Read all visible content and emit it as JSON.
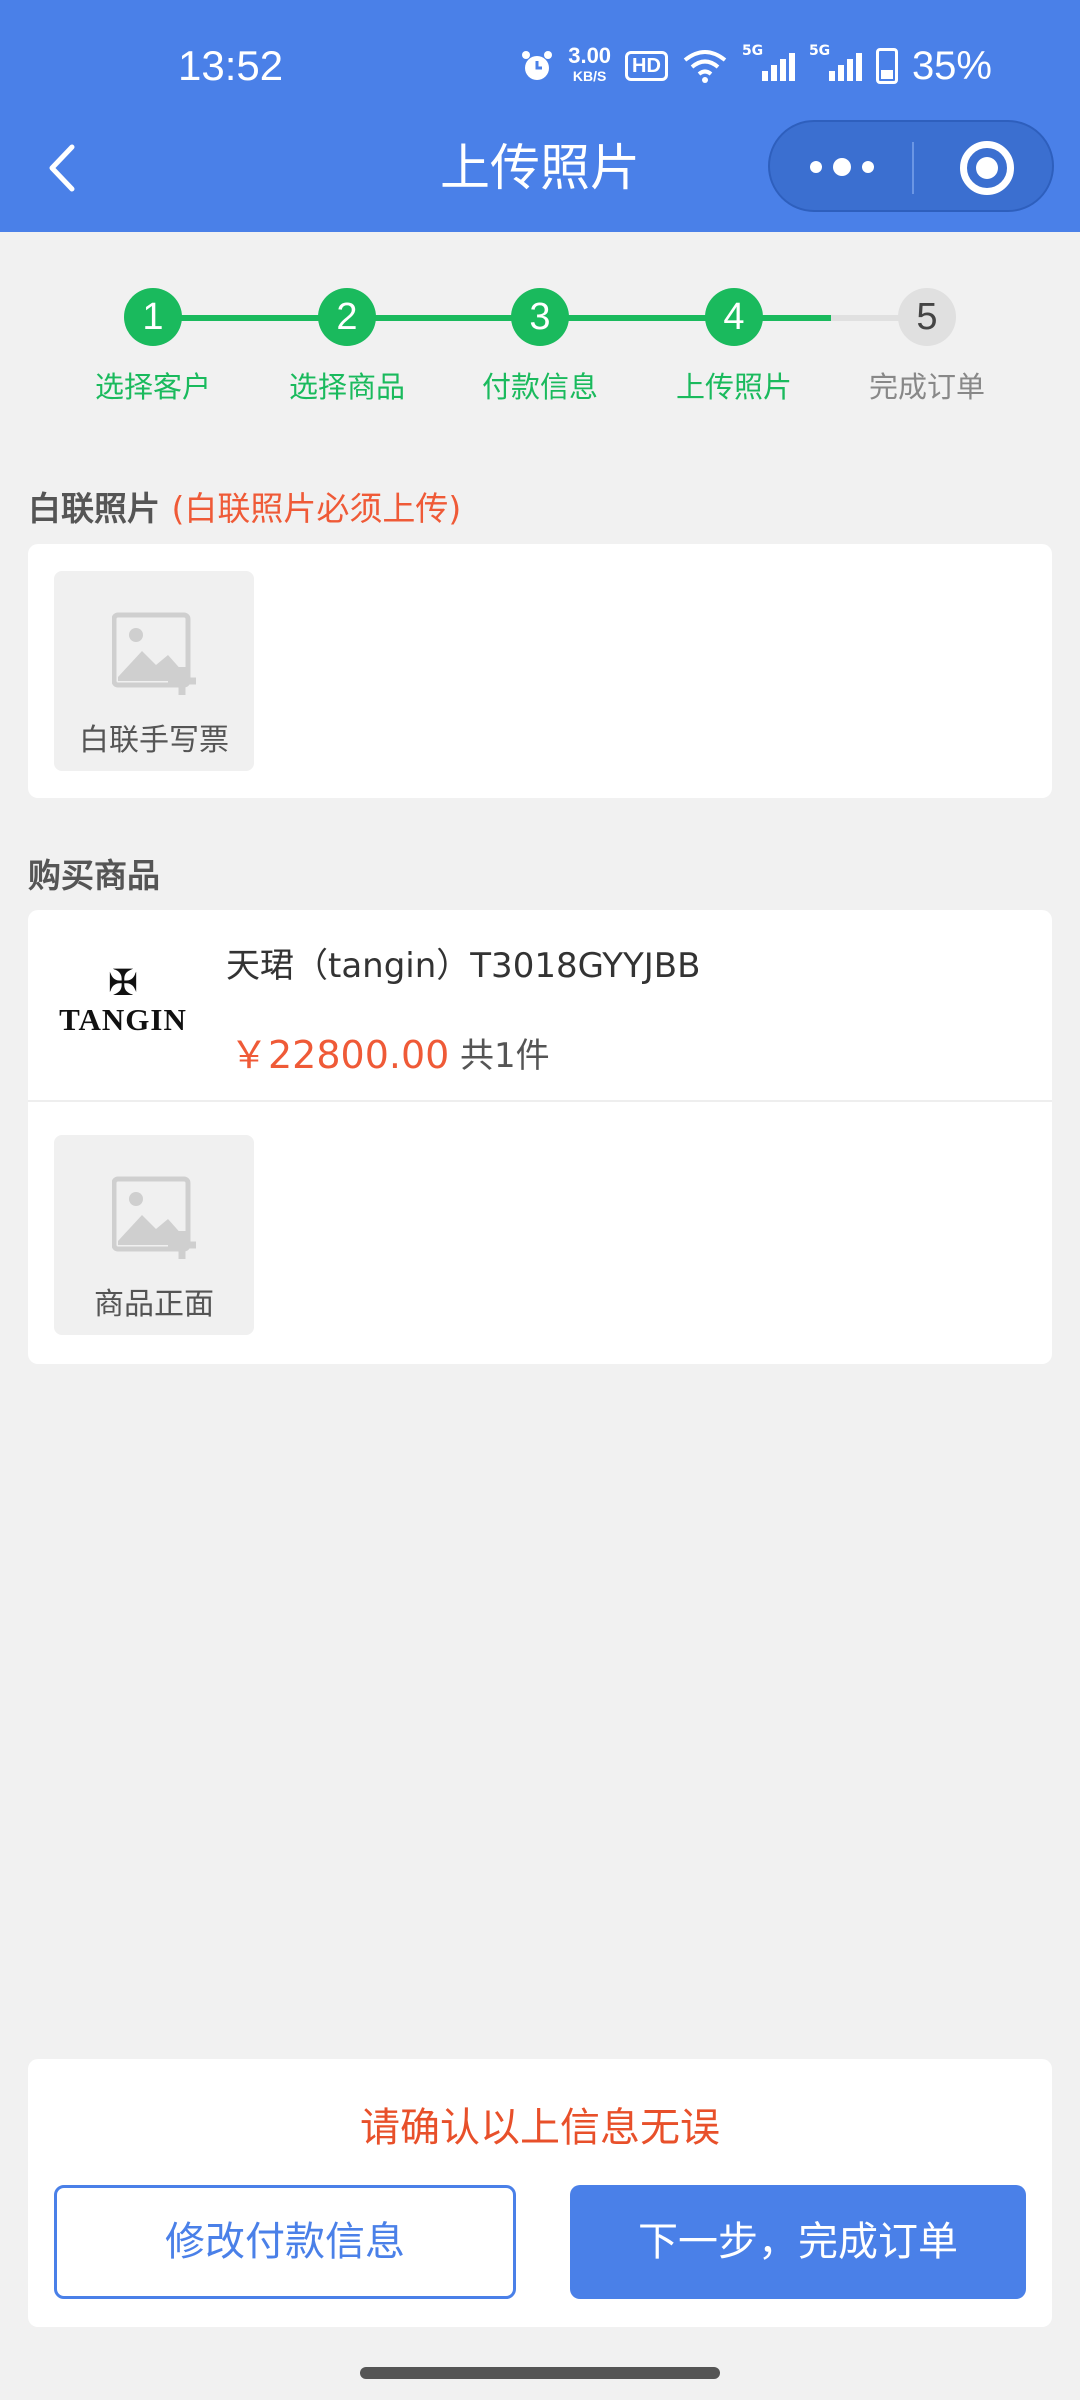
{
  "status_bar": {
    "time": "13:52",
    "net_speed_value": "3.00",
    "net_speed_unit": "KB/S",
    "hd_label": "HD",
    "signal_tag_1": "5G",
    "signal_tag_2": "5G",
    "battery": "35%"
  },
  "nav": {
    "title": "上传照片"
  },
  "steps": [
    {
      "number": "1",
      "label": "选择客户",
      "state": "done"
    },
    {
      "number": "2",
      "label": "选择商品",
      "state": "done"
    },
    {
      "number": "3",
      "label": "付款信息",
      "state": "done"
    },
    {
      "number": "4",
      "label": "上传照片",
      "state": "current"
    },
    {
      "number": "5",
      "label": "完成订单",
      "state": "pending"
    }
  ],
  "receipt_section": {
    "title": "白联照片",
    "note": "(白联照片必须上传)",
    "upload_label": "白联手写票"
  },
  "purchase_section": {
    "title": "购买商品",
    "product": {
      "brand": "TANGIN",
      "name": "天珺（tangin）T3018GYYJBB",
      "price": "￥22800.00",
      "quantity": "共1件"
    },
    "upload_label": "商品正面"
  },
  "footer": {
    "confirm_text": "请确认以上信息无误",
    "modify_button": "修改付款信息",
    "next_button": "下一步，完成订单"
  },
  "colors": {
    "primary": "#4a80e8",
    "success": "#1aba5d",
    "warning": "#ef5a37"
  }
}
